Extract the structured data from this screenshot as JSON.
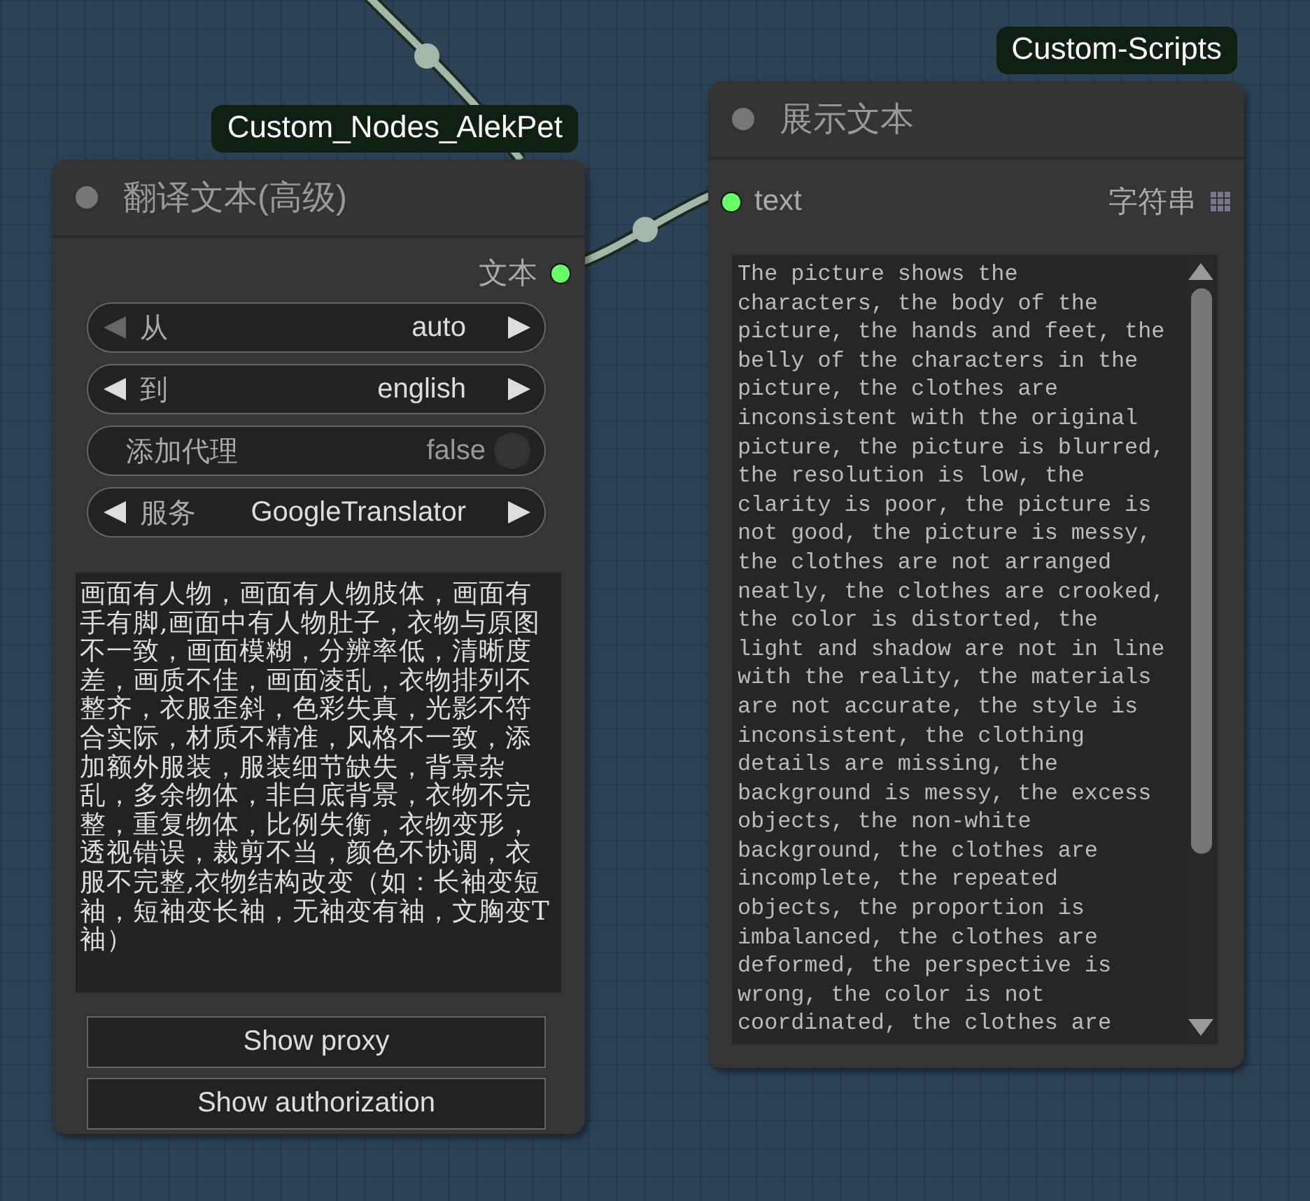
{
  "nodes": [
    {
      "badge": "Custom_Nodes_AlekPet",
      "title": "翻译文本(高级)",
      "outputs": [
        {
          "label": "文本",
          "connected": true
        }
      ],
      "widgets": [
        {
          "kind": "combo",
          "label": "从",
          "value": "auto",
          "prev_disabled": true
        },
        {
          "kind": "combo",
          "label": "到",
          "value": "english",
          "prev_disabled": false
        },
        {
          "kind": "toggle",
          "label": "添加代理",
          "value": "false",
          "on": false
        },
        {
          "kind": "combo",
          "label": "服务",
          "value": "GoogleTranslator",
          "prev_disabled": false
        }
      ],
      "text_area": "画面有人物，画面有人物肢体，画面有手有脚,画面中有人物肚子，衣物与原图不一致，画面模糊，分辨率低，清晰度差，画质不佳，画面凌乱，衣物排列不整齐，衣服歪斜，色彩失真，光影不符合实际，材质不精准，风格不一致，添加额外服装，服装细节缺失，背景杂乱，多余物体，非白底背景，衣物不完整，重复物体，比例失衡，衣物变形，透视错误，裁剪不当，颜色不协调，衣服不完整,衣物结构改变（如：长袖变短袖，短袖变长袖，无袖变有袖，文胸变T袖）",
      "buttons": [
        "Show proxy",
        "Show authorization"
      ]
    },
    {
      "badge": "Custom-Scripts",
      "title": "展示文本",
      "inputs": [
        {
          "label": "text",
          "type": "字符串",
          "connected": true
        }
      ],
      "text_area": "The picture shows the characters, the body of the picture, the hands and feet, the belly of the characters in the picture, the clothes are inconsistent with the original picture, the picture is blurred, the resolution is low, the clarity is poor, the picture is not good, the picture is messy, the clothes are not arranged neatly, the clothes are crooked, the color is distorted, the light and shadow are not in line with the reality, the materials are not accurate, the style is inconsistent, the clothing details are missing, the background is messy, the excess objects, the non-white background, the clothes are incomplete, the repeated objects, the proportion is imbalanced, the clothes are deformed, the perspective is wrong, the color is not coordinated, the clothes are"
    }
  ]
}
